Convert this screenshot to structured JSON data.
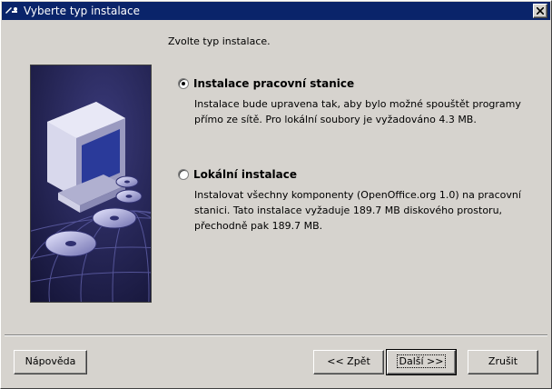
{
  "window": {
    "title": "Vyberte typ instalace",
    "title_icon": "openoffice-icon",
    "close_icon": "close-icon"
  },
  "heading": "Zvolte typ instalace.",
  "options": [
    {
      "label": "Instalace pracovní stanice",
      "checked": true,
      "description": "Instalace bude upravena tak, aby bylo možné spouštět programy přímo ze sítě. Pro lokální soubory je vyžadováno 4.3 MB."
    },
    {
      "label": "Lokální instalace",
      "checked": false,
      "description": "Instalovat všechny komponenty (OpenOffice.org 1.0) na pracovní stanici. Tato instalace vyžaduje 189.7 MB diskového prostoru, přechodně pak 189.7 MB."
    }
  ],
  "buttons": {
    "help": "Nápověda",
    "back": "<< Zpět",
    "next": "Další >>",
    "cancel": "Zrušit"
  }
}
